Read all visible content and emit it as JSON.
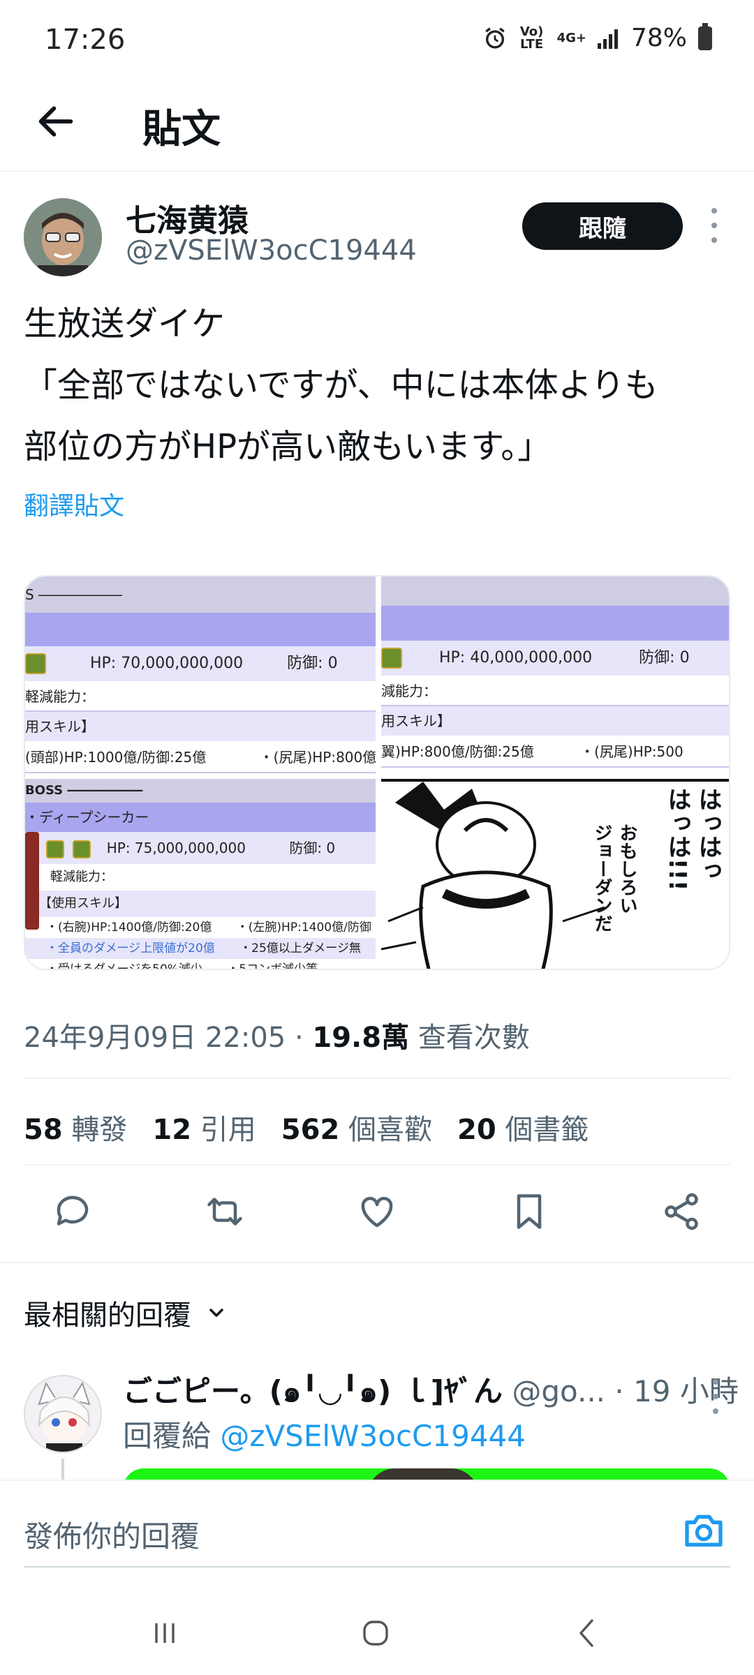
{
  "status_bar": {
    "time": "17:26",
    "volte": "Vo) LTE",
    "network": "4G+",
    "battery": "78%"
  },
  "header": {
    "title": "貼文"
  },
  "post": {
    "author_name": "七海黄猿",
    "author_handle": "@zVSElW3ocC19444",
    "follow_label": "跟隨",
    "text": "生放送ダイケ\n「全部ではないですが、中には本体よりも\n部位の方がHPが高い敵もいます。」",
    "translate_label": "翻譯貼文",
    "timestamp": "24年9月09日 22:05",
    "views_count": "19.8萬",
    "views_label": "查看次數"
  },
  "media": {
    "left": {
      "row1": "S ――――――",
      "hp1": "HP: 70,000,000,000",
      "def1": "防御: 0",
      "reduce": "軽減能力：",
      "skill": "用スキル】",
      "parts1": "(頭部)HP:1000億/防御:25億",
      "parts1b": "・(尻尾)HP:800億",
      "boss": "BOSS ――――――",
      "bossname": "・ディープシーカー",
      "hp2": "HP: 75,000,000,000",
      "def2": "防御: 0",
      "reduce2": "軽減能力：",
      "skill2": "【使用スキル】",
      "p1": "・(右腕)HP:1400億/防御:20億",
      "p1b": "・(左腕)HP:1400億/防御",
      "p2": "・全員のダメージ上限値が20億",
      "p2b": "・25億以上ダメージ無",
      "p3": "・受けるダメージを50%減少",
      "p3b": "・5コンボ減少等"
    },
    "right": {
      "hp": "HP: 40,000,000,000",
      "def": "防御: 0",
      "reduce": "減能力：",
      "skill": "用スキル】",
      "parts": "翼)HP:800億/防御:25億",
      "partsb": "・(尻尾)HP:500",
      "manga_text1": "はっはっ",
      "manga_text2": "はっは!!!",
      "manga_text3": "おもしろい",
      "manga_text4": "ジョーダンだ"
    }
  },
  "stats": {
    "retweets_count": "58",
    "retweets_label": "轉發",
    "quotes_count": "12",
    "quotes_label": "引用",
    "likes_count": "562",
    "likes_label": "個喜歡",
    "bookmarks_count": "20",
    "bookmarks_label": "個書籤"
  },
  "replies": {
    "section_label": "最相關的回覆",
    "items": [
      {
        "name": "ごごピー。(๑╹◡╹๑) ｌ]ﾔﾞん",
        "handle": "@go...",
        "time": "· 19 小時",
        "reply_to_label": "回覆給",
        "reply_to_handle": "@zVSElW3ocC19444"
      }
    ]
  },
  "compose": {
    "placeholder": "發佈你的回覆"
  },
  "colors": {
    "accent": "#1d9bf0",
    "text": "#0f1419",
    "muted": "#536471"
  }
}
